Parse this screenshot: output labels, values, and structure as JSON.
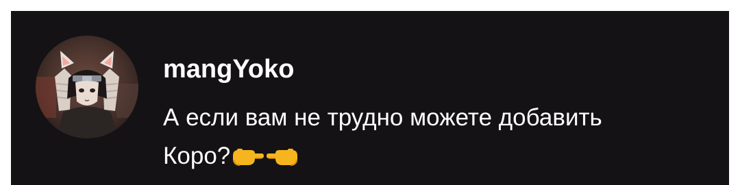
{
  "comment": {
    "username": "mangYoko",
    "message_line1": "А если вам не трудно можете добавить",
    "message_line2": "Коро?",
    "emojis": [
      "backhand-index-pointing-right-emoji",
      "backhand-index-pointing-right-emoji"
    ]
  },
  "colors": {
    "card_background": "#141215",
    "text": "#ffffff",
    "page_background": "#ffffff"
  }
}
